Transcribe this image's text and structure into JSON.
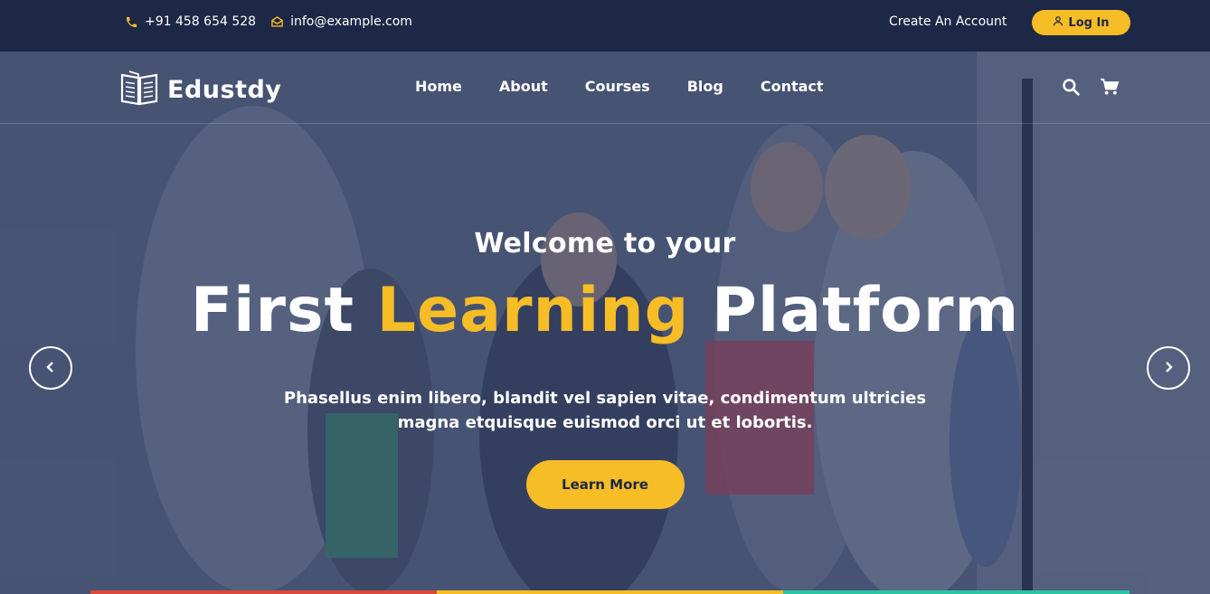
{
  "topbar": {
    "phone": "+91 458 654 528",
    "email": "info@example.com",
    "create_account": "Create An Account",
    "login": "Log In"
  },
  "brand": {
    "name": "Edustdy"
  },
  "nav": {
    "items": [
      {
        "label": "Home"
      },
      {
        "label": "About"
      },
      {
        "label": "Courses"
      },
      {
        "label": "Blog"
      },
      {
        "label": "Contact"
      }
    ],
    "icons": [
      "search-icon",
      "cart-icon"
    ]
  },
  "hero": {
    "welcome": "Welcome to your",
    "headline_first": "First",
    "headline_accent": "Learning",
    "headline_last": "Platform",
    "description": "Phasellus enim libero, blandit vel sapien vitae, condimentum ultricies magna etquisque euismod orci ut et lobortis.",
    "button": "Learn More"
  },
  "colors": {
    "accent": "#f7bd27",
    "topbar_bg": "#1c2845",
    "strip": [
      "#d94a3c",
      "#f7bd27",
      "#2ec4a6"
    ]
  }
}
